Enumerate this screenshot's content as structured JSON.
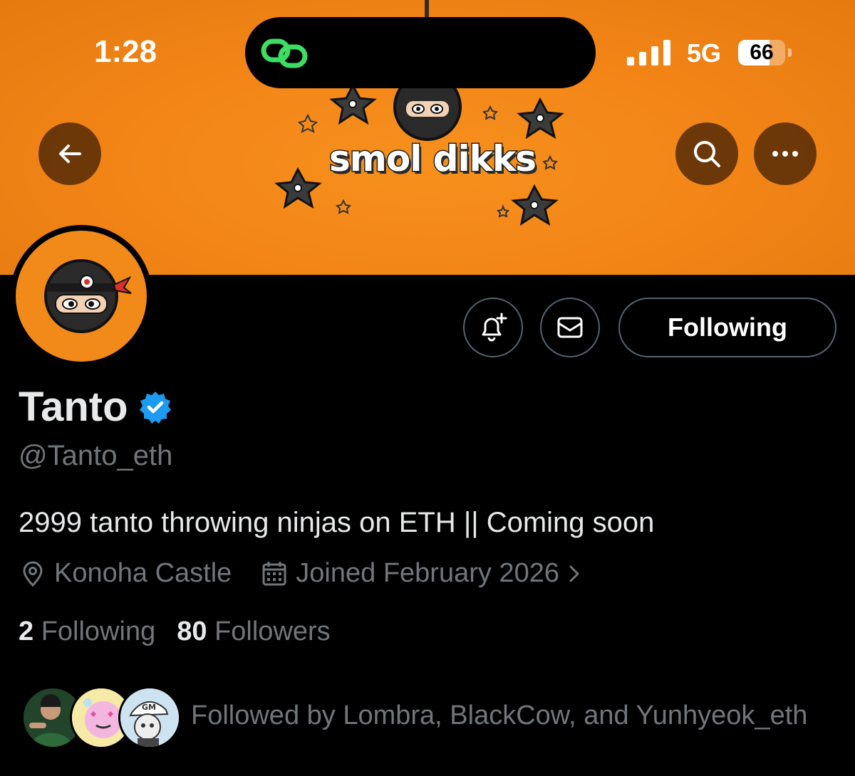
{
  "status_bar": {
    "time": "1:28",
    "network": "5G",
    "battery": "66",
    "battery_level": 0.66
  },
  "banner": {
    "text": "smol dikks"
  },
  "nav": {
    "back_icon": "arrow-left-icon",
    "search_icon": "search-icon",
    "more_icon": "more-icon"
  },
  "actions": {
    "notify_icon": "bell-plus-icon",
    "message_icon": "envelope-icon",
    "following_label": "Following"
  },
  "profile": {
    "name": "Tanto",
    "handle": "@Tanto_eth",
    "bio": "2999 tanto throwing ninjas on ETH || Coming soon",
    "location": "Konoha Castle",
    "joined": "Joined February 2026"
  },
  "stats": {
    "following_count": "2",
    "following_label": "Following",
    "followers_count": "80",
    "followers_label": "Followers"
  },
  "followed_by": {
    "text": "Followed by Lombra, BlackCow, and Yunhyeok_eth"
  },
  "colors": {
    "banner": "#f28416",
    "verified": "#1d9bf0",
    "muted_text": "#71767b"
  }
}
